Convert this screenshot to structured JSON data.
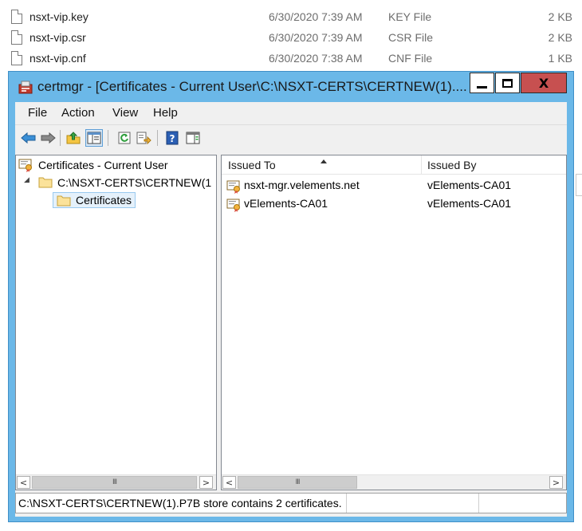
{
  "explorer": {
    "files": [
      {
        "name": "nsxt-vip.key",
        "date": "6/30/2020 7:39 AM",
        "type": "KEY File",
        "size": "2 KB"
      },
      {
        "name": "nsxt-vip.csr",
        "date": "6/30/2020 7:39 AM",
        "type": "CSR File",
        "size": "2 KB"
      },
      {
        "name": "nsxt-vip.cnf",
        "date": "6/30/2020 7:38 AM",
        "type": "CNF File",
        "size": "1 KB"
      }
    ]
  },
  "window": {
    "title": "certmgr - [Certificates - Current User\\C:\\NSXT-CERTS\\CERTNEW(1)....",
    "close_glyph": "X"
  },
  "menu": {
    "items": [
      "File",
      "Action",
      "View",
      "Help"
    ]
  },
  "toolbar": {
    "icons": [
      "back-icon",
      "forward-icon",
      "up-folder-icon",
      "show-hide-tree-icon",
      "refresh-icon",
      "export-list-icon",
      "help-icon",
      "action-pane-icon"
    ]
  },
  "tree": {
    "root": "Certificates - Current User",
    "store": "C:\\NSXT-CERTS\\CERTNEW(1",
    "expander": "◢",
    "child": "Certificates",
    "scroll_left": "<",
    "scroll_right": ">",
    "scroll_grip": "III"
  },
  "list": {
    "columns": [
      "Issued To",
      "Issued By"
    ],
    "sort_column": "Issued To",
    "rows": [
      {
        "issued_to": "nsxt-mgr.velements.net",
        "issued_by": "vElements-CA01"
      },
      {
        "issued_to": "vElements-CA01",
        "issued_by": "vElements-CA01"
      }
    ],
    "scroll_left": "<",
    "scroll_right": ">",
    "scroll_grip": "III"
  },
  "status": {
    "text": "C:\\NSXT-CERTS\\CERTNEW(1).P7B store contains 2 certificates."
  },
  "colors": {
    "title_bar": "#6bb8e8",
    "close_button": "#c75050",
    "selection": "#e5f1fb"
  }
}
